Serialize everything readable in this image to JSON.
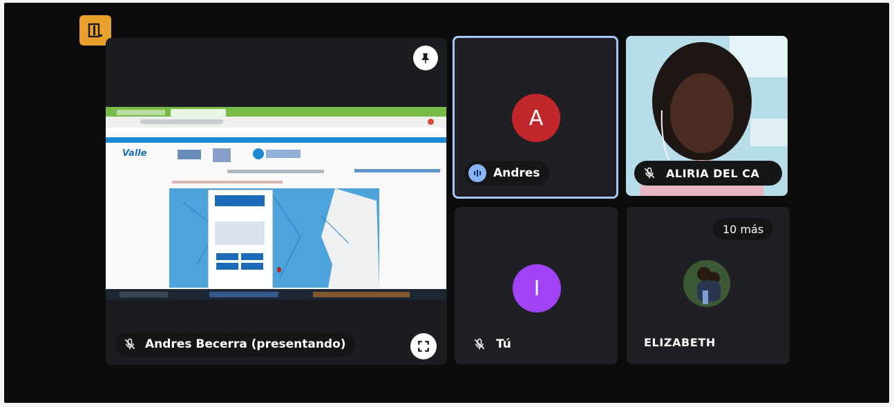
{
  "colors": {
    "background": "#0b0b0c",
    "tile": "#1f2023",
    "accent_outline": "#a8c7fa",
    "avatar_a": "#c1272d",
    "avatar_i": "#a142f4",
    "door_button": "#e8a12c",
    "speaking_indicator": "#8ab4f8"
  },
  "toolbar": {
    "door_icon": "door-icon"
  },
  "presenter_tile": {
    "name": "Andres Becerra (presentando)",
    "mic_icon": "mic-off-icon",
    "pin_icon": "pin-icon",
    "fullscreen_icon": "fullscreen-icon"
  },
  "andres_tile": {
    "avatar_letter": "A",
    "name": "Andres",
    "indicator_icon": "speaking-icon"
  },
  "aliria_tile": {
    "name": "ALIRIA DEL CA",
    "mic_icon": "mic-off-icon"
  },
  "self_tile": {
    "avatar_letter": "I",
    "name": "Tú",
    "mic_icon": "mic-off-icon"
  },
  "more_tile": {
    "more_count": "10 más",
    "name": "ELIZABETH"
  },
  "shared_screen": {
    "brand": "Valle"
  }
}
